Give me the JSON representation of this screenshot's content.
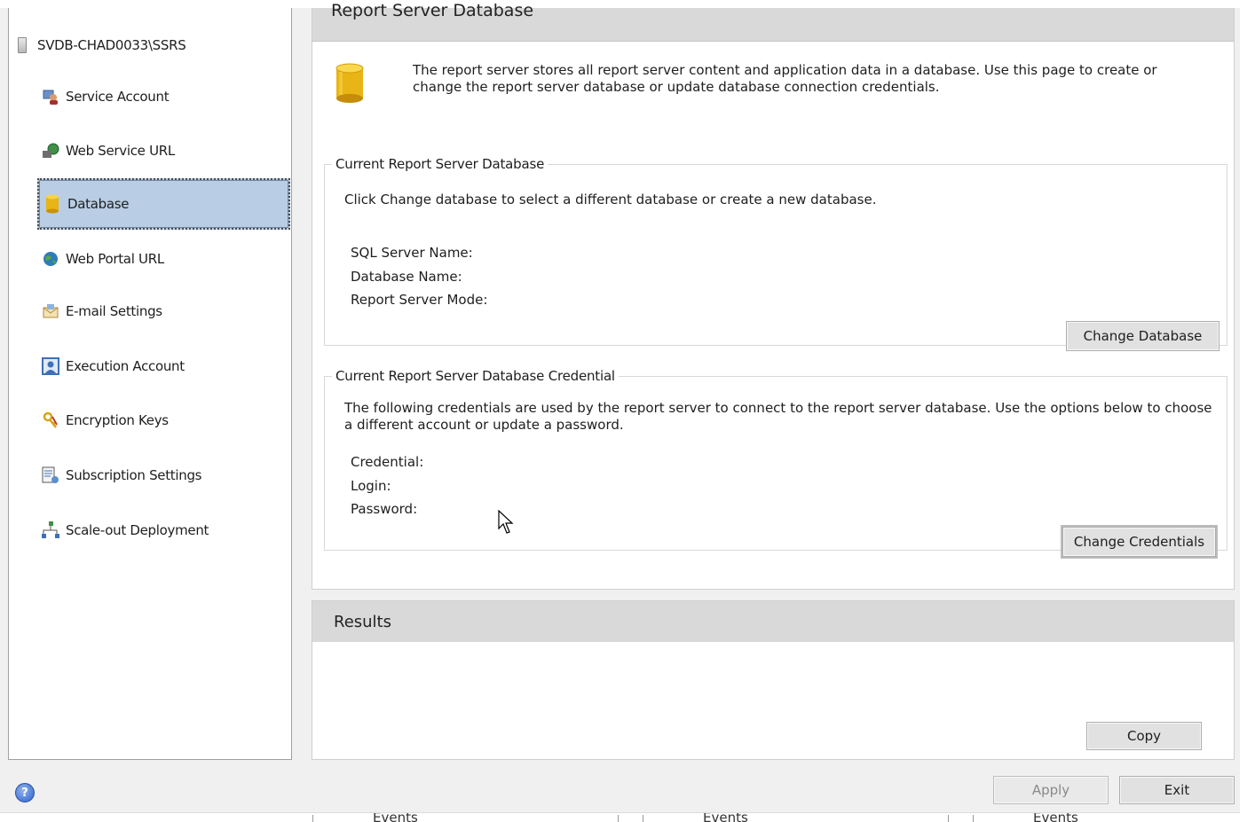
{
  "sidebar": {
    "server_name": "SVDB-CHAD0033\\SSRS",
    "items": [
      {
        "label": "Service Account",
        "icon": "service-account-icon"
      },
      {
        "label": "Web Service URL",
        "icon": "web-service-url-icon"
      },
      {
        "label": "Database",
        "icon": "database-icon",
        "selected": true
      },
      {
        "label": "Web Portal URL",
        "icon": "globe-icon"
      },
      {
        "label": "E-mail Settings",
        "icon": "email-icon"
      },
      {
        "label": "Execution Account",
        "icon": "execution-account-icon"
      },
      {
        "label": "Encryption Keys",
        "icon": "keys-icon"
      },
      {
        "label": "Subscription Settings",
        "icon": "subscription-icon"
      },
      {
        "label": "Scale-out Deployment",
        "icon": "scale-out-icon"
      }
    ]
  },
  "main": {
    "title": "Report Server Database",
    "intro": "The report server stores all report server content and application data in a database. Use this page to create or change the report server database or update database connection credentials.",
    "current_db": {
      "legend": "Current Report Server Database",
      "description": "Click Change database to select a different database or create a new database.",
      "labels": [
        "SQL Server Name:",
        "Database Name:",
        "Report Server Mode:"
      ],
      "button": "Change Database"
    },
    "credential": {
      "legend": "Current Report Server Database Credential",
      "description": "The following credentials are used by the report server to connect to the report server database.  Use the options below to choose a different account or update a password.",
      "labels": [
        "Credential:",
        "Login:",
        "Password:"
      ],
      "button": "Change Credentials"
    }
  },
  "results": {
    "title": "Results",
    "copy_button": "Copy"
  },
  "footer": {
    "apply_button": "Apply",
    "exit_button": "Exit",
    "help_glyph": "?"
  },
  "taskbar_fragments": [
    "Events",
    "Events",
    "Events"
  ]
}
